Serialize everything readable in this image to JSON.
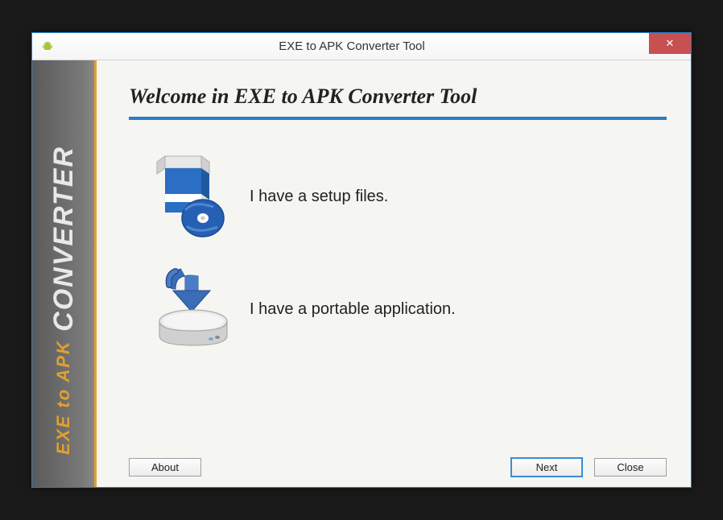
{
  "window": {
    "title": "EXE to APK Converter Tool",
    "icon_name": "android-icon"
  },
  "sidebar": {
    "line1": "EXE to APK",
    "line2": "CONVERTER"
  },
  "main": {
    "heading": "Welcome in EXE to APK Converter Tool",
    "options": [
      {
        "icon": "setup-box-disc-icon",
        "label": "I have a setup files."
      },
      {
        "icon": "download-drive-icon",
        "label": "I have a portable application."
      }
    ]
  },
  "buttons": {
    "about": "About",
    "next": "Next",
    "close": "Close"
  },
  "close_x": "✕"
}
